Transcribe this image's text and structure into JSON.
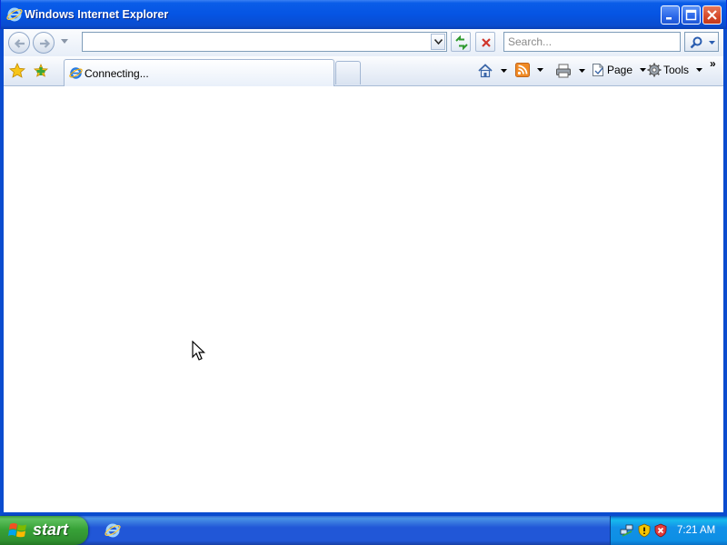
{
  "window": {
    "title": "Windows Internet Explorer"
  },
  "address": {
    "value": "",
    "search_placeholder": "Search..."
  },
  "tabs": [
    {
      "label": "Connecting..."
    }
  ],
  "commands": {
    "page_label": "Page",
    "tools_label": "Tools"
  },
  "taskbar": {
    "start_label": "start",
    "clock": "7:21 AM"
  },
  "colors": {
    "titlebar": "#0554e3",
    "taskbar": "#2157d7",
    "start_button": "#38a238",
    "close_button": "#d6492a"
  },
  "icons": {
    "title": "ie-logo-icon",
    "back": "back-arrow-icon",
    "forward": "forward-arrow-icon",
    "refresh": "refresh-icon",
    "stop": "stop-icon",
    "search": "magnifier-icon",
    "favorites": "star-icon",
    "add_favorite": "add-favorite-icon",
    "home": "home-icon",
    "feeds": "rss-icon",
    "print": "printer-icon",
    "page": "page-icon",
    "tools": "gear-icon"
  }
}
